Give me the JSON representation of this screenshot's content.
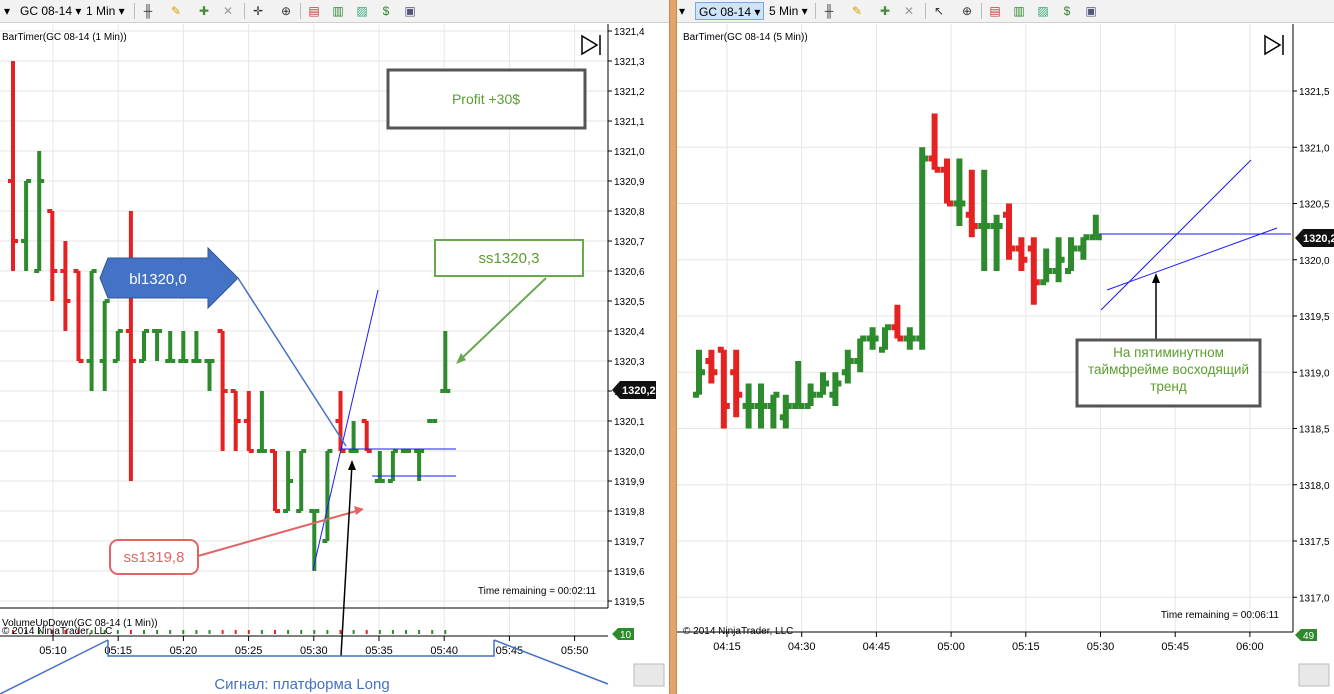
{
  "colors": {
    "up": "#2d8a2d",
    "down": "#e52222",
    "grid": "#e6e6e6",
    "link": "#4472c4",
    "divider": "#e3a36a"
  },
  "left": {
    "toolbar": {
      "instrument": "GC 08-14",
      "interval": "1 Min"
    },
    "indicator_title": "BarTimer(GC 08-14 (1 Min))",
    "price_axis": [
      "1321,4",
      "1321,3",
      "1321,2",
      "1321,1",
      "1321,0",
      "1320,9",
      "1320,8",
      "1320,7",
      "1320,6",
      "1320,5",
      "1320,4",
      "1320,3",
      "1320,2",
      "1320,1",
      "1320,0",
      "1319,9",
      "1319,8",
      "1319,7",
      "1319,6",
      "1319,5"
    ],
    "current_price": "1320,2",
    "time_axis": [
      "05:10",
      "05:15",
      "05:20",
      "05:25",
      "05:30",
      "05:35",
      "05:40",
      "05:45",
      "05:50"
    ],
    "time_remaining": "Time remaining = 00:02:11",
    "volume_title": "VolumeUpDown(GC 08-14 (1 Min))",
    "copyright": "© 2014 NinjaTrader, LLC",
    "volume_badge": "10",
    "callouts": {
      "profit": "Profit +30$",
      "buy_limit": "bl1320,0",
      "sell_stop_high": "ss1320,3",
      "sell_stop_low": "ss1319,8",
      "signal": "Сигнал: платформа Long"
    }
  },
  "right": {
    "toolbar": {
      "instrument": "GC 08-14",
      "interval": "5 Min"
    },
    "indicator_title": "BarTimer(GC 08-14 (5 Min))",
    "price_axis": [
      "1321,5",
      "1321,0",
      "1320,5",
      "1320,0",
      "1319,5",
      "1319,0",
      "1318,5",
      "1318,0",
      "1317,5",
      "1317,0"
    ],
    "current_price": "1320,2",
    "time_axis": [
      "04:15",
      "04:30",
      "04:45",
      "05:00",
      "05:15",
      "05:30",
      "05:45",
      "06:00"
    ],
    "time_remaining": "Time remaining = 00:06:11",
    "copyright": "© 2014 NinjaTrader, LLC",
    "volume_badge": "49",
    "callout": "На пятиминутном таймфрейме восходящий тренд"
  },
  "chart_data": [
    {
      "type": "ohlc",
      "title": "BarTimer(GC 08-14 (1 Min))",
      "timeframe": "1 Min",
      "bars": [
        {
          "o": 1320.9,
          "h": 1321.3,
          "l": 1320.6,
          "c": 1320.7
        },
        {
          "o": 1320.7,
          "h": 1320.9,
          "l": 1320.6,
          "c": 1320.9
        },
        {
          "o": 1320.6,
          "h": 1321.0,
          "l": 1320.6,
          "c": 1320.9
        },
        {
          "o": 1320.8,
          "h": 1320.8,
          "l": 1320.5,
          "c": 1320.6
        },
        {
          "o": 1320.6,
          "h": 1320.7,
          "l": 1320.4,
          "c": 1320.5
        },
        {
          "o": 1320.6,
          "h": 1320.6,
          "l": 1320.3,
          "c": 1320.3
        },
        {
          "o": 1320.3,
          "h": 1320.6,
          "l": 1320.2,
          "c": 1320.6
        },
        {
          "o": 1320.3,
          "h": 1320.5,
          "l": 1320.2,
          "c": 1320.5
        },
        {
          "o": 1320.3,
          "h": 1320.4,
          "l": 1320.3,
          "c": 1320.4
        },
        {
          "o": 1320.4,
          "h": 1320.8,
          "l": 1319.9,
          "c": 1320.3
        },
        {
          "o": 1320.3,
          "h": 1320.4,
          "l": 1320.3,
          "c": 1320.4
        },
        {
          "o": 1320.4,
          "h": 1320.4,
          "l": 1320.3,
          "c": 1320.4
        },
        {
          "o": 1320.3,
          "h": 1320.4,
          "l": 1320.3,
          "c": 1320.3
        },
        {
          "o": 1320.3,
          "h": 1320.4,
          "l": 1320.3,
          "c": 1320.3
        },
        {
          "o": 1320.3,
          "h": 1320.4,
          "l": 1320.3,
          "c": 1320.3
        },
        {
          "o": 1320.3,
          "h": 1320.3,
          "l": 1320.2,
          "c": 1320.3
        },
        {
          "o": 1320.4,
          "h": 1320.4,
          "l": 1320.0,
          "c": 1320.2
        },
        {
          "o": 1320.2,
          "h": 1320.2,
          "l": 1320.0,
          "c": 1320.1
        },
        {
          "o": 1320.1,
          "h": 1320.2,
          "l": 1320.0,
          "c": 1320.0
        },
        {
          "o": 1320.0,
          "h": 1320.2,
          "l": 1320.0,
          "c": 1320.0
        },
        {
          "o": 1320.0,
          "h": 1320.0,
          "l": 1319.8,
          "c": 1319.8
        },
        {
          "o": 1319.8,
          "h": 1320.0,
          "l": 1319.8,
          "c": 1319.9
        },
        {
          "o": 1319.8,
          "h": 1320.0,
          "l": 1319.8,
          "c": 1320.0
        },
        {
          "o": 1319.8,
          "h": 1319.8,
          "l": 1319.6,
          "c": 1319.8
        },
        {
          "o": 1319.7,
          "h": 1320.0,
          "l": 1319.7,
          "c": 1320.0
        },
        {
          "o": 1320.1,
          "h": 1320.2,
          "l": 1320.0,
          "c": 1320.0
        },
        {
          "o": 1320.0,
          "h": 1320.1,
          "l": 1320.0,
          "c": 1320.0
        },
        {
          "o": 1320.1,
          "h": 1320.1,
          "l": 1320.0,
          "c": 1320.0
        },
        {
          "o": 1319.9,
          "h": 1320.0,
          "l": 1319.9,
          "c": 1319.9
        },
        {
          "o": 1319.9,
          "h": 1320.0,
          "l": 1319.9,
          "c": 1320.0
        },
        {
          "o": 1320.0,
          "h": 1320.0,
          "l": 1320.0,
          "c": 1320.0
        },
        {
          "o": 1320.0,
          "h": 1320.0,
          "l": 1319.9,
          "c": 1320.0
        },
        {
          "o": 1320.1,
          "h": 1320.1,
          "l": 1320.1,
          "c": 1320.1
        },
        {
          "o": 1320.2,
          "h": 1320.4,
          "l": 1320.2,
          "c": 1320.2
        }
      ]
    },
    {
      "type": "ohlc",
      "title": "BarTimer(GC 08-14 (5 Min))",
      "timeframe": "5 Min",
      "bars": [
        {
          "o": 1318.8,
          "h": 1319.2,
          "l": 1318.8,
          "c": 1319.0
        },
        {
          "o": 1319.1,
          "h": 1319.2,
          "l": 1318.9,
          "c": 1319.0
        },
        {
          "o": 1319.2,
          "h": 1319.2,
          "l": 1318.5,
          "c": 1318.7
        },
        {
          "o": 1319.0,
          "h": 1319.2,
          "l": 1318.6,
          "c": 1318.8
        },
        {
          "o": 1318.7,
          "h": 1318.9,
          "l": 1318.5,
          "c": 1318.7
        },
        {
          "o": 1318.7,
          "h": 1318.9,
          "l": 1318.5,
          "c": 1318.7
        },
        {
          "o": 1318.7,
          "h": 1318.8,
          "l": 1318.5,
          "c": 1318.8
        },
        {
          "o": 1318.6,
          "h": 1318.8,
          "l": 1318.5,
          "c": 1318.7
        },
        {
          "o": 1318.7,
          "h": 1319.1,
          "l": 1318.7,
          "c": 1318.7
        },
        {
          "o": 1318.7,
          "h": 1318.9,
          "l": 1318.7,
          "c": 1318.8
        },
        {
          "o": 1318.8,
          "h": 1319.0,
          "l": 1318.8,
          "c": 1318.9
        },
        {
          "o": 1318.8,
          "h": 1319.0,
          "l": 1318.7,
          "c": 1318.9
        },
        {
          "o": 1319.0,
          "h": 1319.2,
          "l": 1318.9,
          "c": 1319.1
        },
        {
          "o": 1319.1,
          "h": 1319.3,
          "l": 1319.0,
          "c": 1319.3
        },
        {
          "o": 1319.3,
          "h": 1319.4,
          "l": 1319.2,
          "c": 1319.3
        },
        {
          "o": 1319.2,
          "h": 1319.4,
          "l": 1319.2,
          "c": 1319.4
        },
        {
          "o": 1319.4,
          "h": 1319.6,
          "l": 1319.3,
          "c": 1319.3
        },
        {
          "o": 1319.3,
          "h": 1319.4,
          "l": 1319.2,
          "c": 1319.3
        },
        {
          "o": 1319.3,
          "h": 1321.0,
          "l": 1319.2,
          "c": 1320.9
        },
        {
          "o": 1320.9,
          "h": 1321.3,
          "l": 1320.8,
          "c": 1320.8
        },
        {
          "o": 1320.8,
          "h": 1320.9,
          "l": 1320.5,
          "c": 1320.5
        },
        {
          "o": 1320.5,
          "h": 1320.9,
          "l": 1320.3,
          "c": 1320.5
        },
        {
          "o": 1320.4,
          "h": 1320.8,
          "l": 1320.2,
          "c": 1320.3
        },
        {
          "o": 1320.3,
          "h": 1320.8,
          "l": 1319.9,
          "c": 1320.3
        },
        {
          "o": 1320.3,
          "h": 1320.4,
          "l": 1319.9,
          "c": 1320.3
        },
        {
          "o": 1320.4,
          "h": 1320.5,
          "l": 1320.0,
          "c": 1320.1
        },
        {
          "o": 1320.1,
          "h": 1320.2,
          "l": 1319.9,
          "c": 1320.0
        },
        {
          "o": 1320.1,
          "h": 1320.2,
          "l": 1319.6,
          "c": 1319.8
        },
        {
          "o": 1319.8,
          "h": 1320.1,
          "l": 1319.8,
          "c": 1319.9
        },
        {
          "o": 1319.9,
          "h": 1320.2,
          "l": 1319.8,
          "c": 1320.0
        },
        {
          "o": 1319.9,
          "h": 1320.2,
          "l": 1319.9,
          "c": 1320.1
        },
        {
          "o": 1320.1,
          "h": 1320.2,
          "l": 1320.0,
          "c": 1320.2
        },
        {
          "o": 1320.2,
          "h": 1320.4,
          "l": 1320.2,
          "c": 1320.2
        }
      ]
    }
  ]
}
